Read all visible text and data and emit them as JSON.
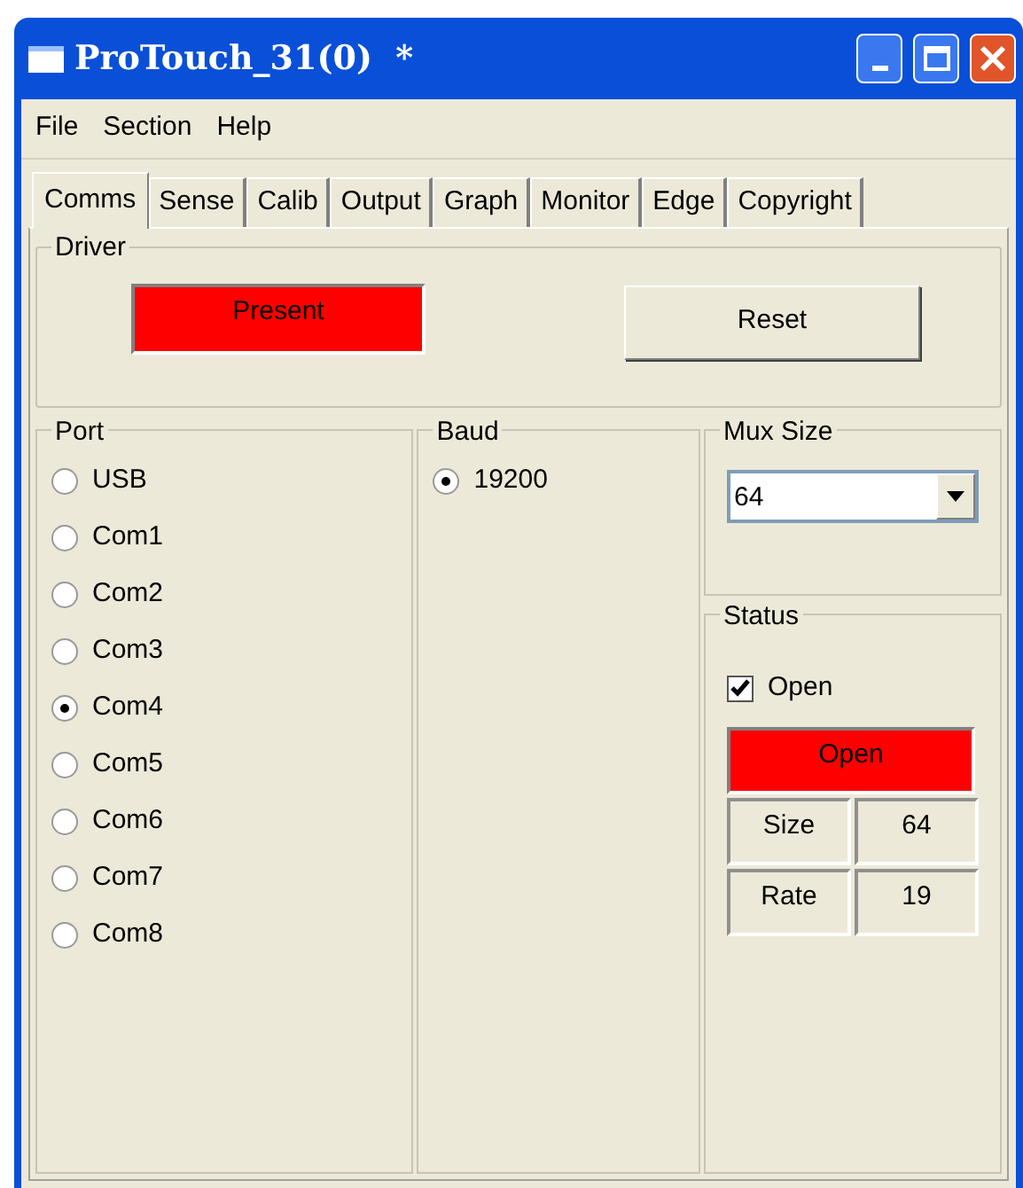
{
  "window": {
    "title": "ProTouch_31(0)  *"
  },
  "menu": [
    "File",
    "Section",
    "Help"
  ],
  "tabs": [
    {
      "label": "Comms",
      "selected": true
    },
    {
      "label": "Sense",
      "selected": false
    },
    {
      "label": "Calib",
      "selected": false
    },
    {
      "label": "Output",
      "selected": false
    },
    {
      "label": "Graph",
      "selected": false
    },
    {
      "label": "Monitor",
      "selected": false
    },
    {
      "label": "Edge",
      "selected": false
    },
    {
      "label": "Copyright",
      "selected": false
    }
  ],
  "driver": {
    "title": "Driver",
    "indicator": {
      "label": "Present",
      "on": true
    },
    "reset_button": "Reset"
  },
  "port": {
    "title": "Port",
    "options": [
      {
        "label": "USB",
        "selected": false
      },
      {
        "label": "Com1",
        "selected": false
      },
      {
        "label": "Com2",
        "selected": false
      },
      {
        "label": "Com3",
        "selected": false
      },
      {
        "label": "Com4",
        "selected": true
      },
      {
        "label": "Com5",
        "selected": false
      },
      {
        "label": "Com6",
        "selected": false
      },
      {
        "label": "Com7",
        "selected": false
      },
      {
        "label": "Com8",
        "selected": false
      }
    ]
  },
  "baud": {
    "title": "Baud",
    "options": [
      {
        "label": "19200",
        "selected": true
      }
    ]
  },
  "mux_size": {
    "title": "Mux Size",
    "value": "64"
  },
  "status": {
    "title": "Status",
    "checkbox": {
      "label": "Open",
      "checked": true
    },
    "indicator": {
      "label": "Open",
      "on": true
    },
    "rows": [
      {
        "label": "Size",
        "value": "64"
      },
      {
        "label": "Rate",
        "value": "19"
      }
    ]
  }
}
